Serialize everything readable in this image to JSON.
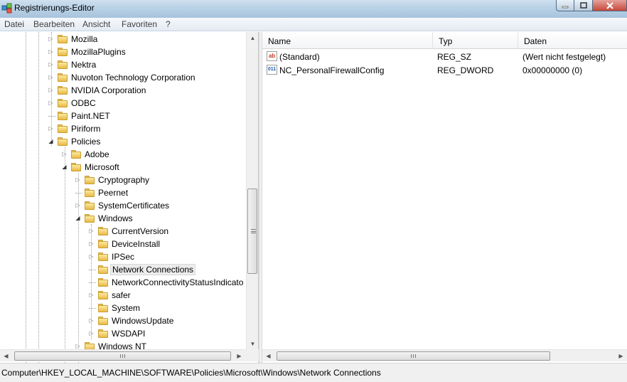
{
  "window": {
    "title": "Registrierungs-Editor",
    "icon": "regedit-icon"
  },
  "menu": [
    "Datei",
    "Bearbeiten",
    "Ansicht",
    "Favoriten",
    "?"
  ],
  "tree": [
    {
      "label": "Mozilla",
      "depth": 0,
      "expander": "collapsed"
    },
    {
      "label": "MozillaPlugins",
      "depth": 0,
      "expander": "collapsed"
    },
    {
      "label": "Nektra",
      "depth": 0,
      "expander": "collapsed"
    },
    {
      "label": "Nuvoton Technology Corporation",
      "depth": 0,
      "expander": "collapsed"
    },
    {
      "label": "NVIDIA Corporation",
      "depth": 0,
      "expander": "collapsed"
    },
    {
      "label": "ODBC",
      "depth": 0,
      "expander": "collapsed"
    },
    {
      "label": "Paint.NET",
      "depth": 0,
      "expander": "none"
    },
    {
      "label": "Piriform",
      "depth": 0,
      "expander": "collapsed"
    },
    {
      "label": "Policies",
      "depth": 0,
      "expander": "expanded"
    },
    {
      "label": "Adobe",
      "depth": 1,
      "expander": "collapsed"
    },
    {
      "label": "Microsoft",
      "depth": 1,
      "expander": "expanded"
    },
    {
      "label": "Cryptography",
      "depth": 2,
      "expander": "collapsed"
    },
    {
      "label": "Peernet",
      "depth": 2,
      "expander": "none"
    },
    {
      "label": "SystemCertificates",
      "depth": 2,
      "expander": "collapsed"
    },
    {
      "label": "Windows",
      "depth": 2,
      "expander": "expanded"
    },
    {
      "label": "CurrentVersion",
      "depth": 3,
      "expander": "collapsed"
    },
    {
      "label": "DeviceInstall",
      "depth": 3,
      "expander": "collapsed"
    },
    {
      "label": "IPSec",
      "depth": 3,
      "expander": "collapsed"
    },
    {
      "label": "Network Connections",
      "depth": 3,
      "expander": "none",
      "selected": true
    },
    {
      "label": "NetworkConnectivityStatusIndicato",
      "depth": 3,
      "expander": "none"
    },
    {
      "label": "safer",
      "depth": 3,
      "expander": "collapsed"
    },
    {
      "label": "System",
      "depth": 3,
      "expander": "none"
    },
    {
      "label": "WindowsUpdate",
      "depth": 3,
      "expander": "collapsed"
    },
    {
      "label": "WSDAPI",
      "depth": 3,
      "expander": "collapsed"
    },
    {
      "label": "Windows NT",
      "depth": 2,
      "expander": "collapsed"
    }
  ],
  "list": {
    "columns": [
      "Name",
      "Typ",
      "Daten"
    ],
    "rows": [
      {
        "icon": "string-value-icon",
        "glyph": "ab",
        "name": "(Standard)",
        "type": "REG_SZ",
        "data": "(Wert nicht festgelegt)"
      },
      {
        "icon": "binary-value-icon",
        "glyph": "011",
        "name": "NC_PersonalFirewallConfig",
        "type": "REG_DWORD",
        "data": "0x00000000 (0)"
      }
    ]
  },
  "status": {
    "path": "Computer\\HKEY_LOCAL_MACHINE\\SOFTWARE\\Policies\\Microsoft\\Windows\\Network Connections"
  },
  "glyphs": {
    "collapsed": "▷",
    "expanded": "◢",
    "up": "▲",
    "down": "▼",
    "left": "◀",
    "right": "▶"
  }
}
